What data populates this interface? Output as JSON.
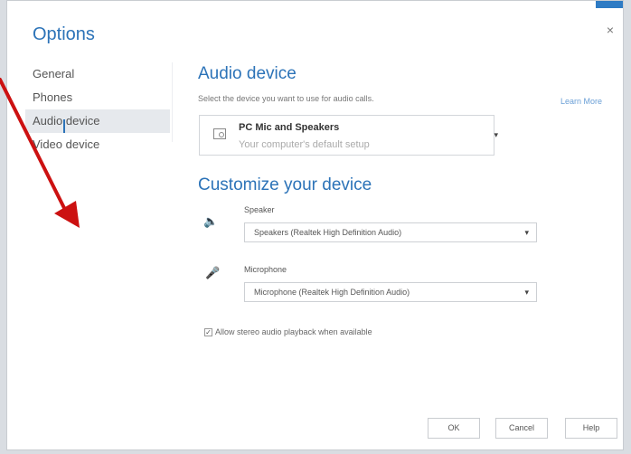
{
  "dialog": {
    "title": "Options",
    "close_label": "×"
  },
  "sidebar": {
    "items": [
      {
        "label": "General"
      },
      {
        "label": "Phones"
      },
      {
        "label": "Audio device",
        "selected": true
      },
      {
        "label": "Video device"
      }
    ]
  },
  "audio_device": {
    "heading": "Audio device",
    "subtitle": "Select the device you want to use for audio calls.",
    "learn_more": "Learn More",
    "selected_device": {
      "name": "PC Mic and Speakers",
      "description": "Your computer's default setup"
    }
  },
  "customize": {
    "heading": "Customize your device",
    "speaker": {
      "label": "Speaker",
      "value": "Speakers (Realtek High Definition Audio)",
      "icon": "speaker-icon"
    },
    "microphone": {
      "label": "Microphone",
      "value": "Microphone (Realtek High Definition Audio)",
      "icon": "microphone-icon"
    },
    "stereo_checkbox": {
      "label": "Allow stereo audio playback when available",
      "checked": true
    }
  },
  "buttons": {
    "ok": "OK",
    "cancel": "Cancel",
    "help": "Help"
  },
  "colors": {
    "accent": "#2c73b8",
    "annotation_arrow": "#cc1111"
  }
}
